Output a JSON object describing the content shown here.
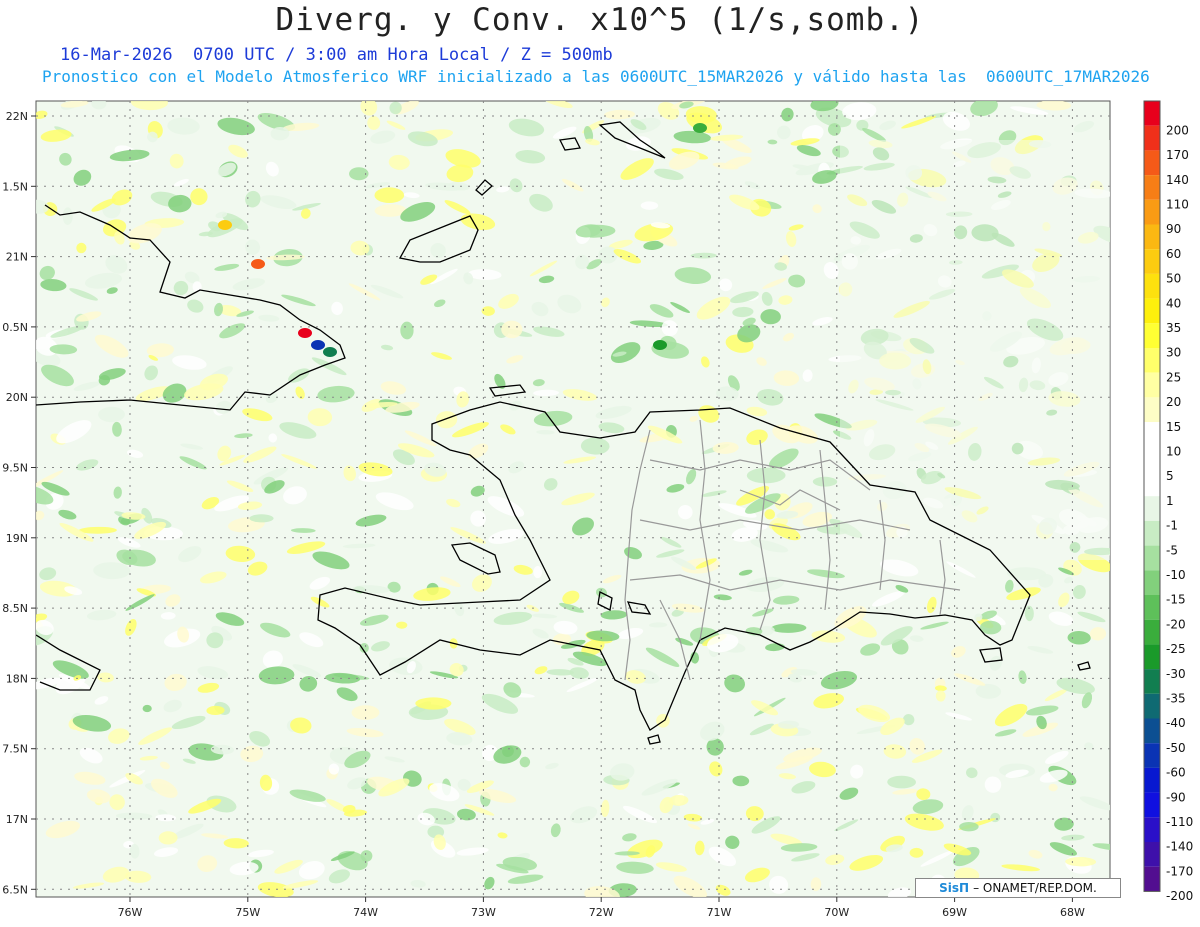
{
  "title": "Diverg. y Conv. x10^5 (1/s,somb.)",
  "subtitle_line1": "16-Mar-2026  0700 UTC / 3:00 am Hora Local / Z = 500mb",
  "subtitle_line2": "Pronostico con el Modelo Atmosferico WRF inicializado a las 0600UTC_15MAR2026 y válido hasta las  0600UTC_17MAR2026",
  "lat_labels": [
    "22N",
    "1.5N",
    "21N",
    "0.5N",
    "20N",
    "9.5N",
    "19N",
    "8.5N",
    "18N",
    "7.5N",
    "17N",
    "6.5N"
  ],
  "lon_labels": [
    "76W",
    "75W",
    "74W",
    "73W",
    "72W",
    "71W",
    "70W",
    "69W",
    "68W"
  ],
  "colorbar": {
    "labels": [
      "200",
      "170",
      "140",
      "110",
      "90",
      "60",
      "50",
      "40",
      "35",
      "30",
      "25",
      "20",
      "15",
      "10",
      "5",
      "1",
      "-1",
      "-5",
      "-10",
      "-15",
      "-20",
      "-25",
      "-30",
      "-35",
      "-40",
      "-50",
      "-60",
      "-90",
      "-110",
      "-140",
      "-170",
      "-200"
    ],
    "colors": [
      "#e8001c",
      "#f0301a",
      "#f55a18",
      "#f77e16",
      "#fa9b14",
      "#fbb812",
      "#fccc10",
      "#fde10e",
      "#fef00c",
      "#ffff33",
      "#ffff6a",
      "#ffffa3",
      "#fdfdc6",
      "#ffffff",
      "#ffffff",
      "#ffffff",
      "#e8f6e6",
      "#c8ecc4",
      "#a6e0a0",
      "#82d07c",
      "#5ec05a",
      "#3aad3c",
      "#1a9a2a",
      "#117e50",
      "#0f6a72",
      "#0c4f92",
      "#0a33b4",
      "#0818d0",
      "#1010e0",
      "#2a10c8",
      "#3e10aa",
      "#520e90"
    ]
  },
  "credit": {
    "logo": "SisΠ",
    "text": "– ONAMET/REP.DOM."
  }
}
